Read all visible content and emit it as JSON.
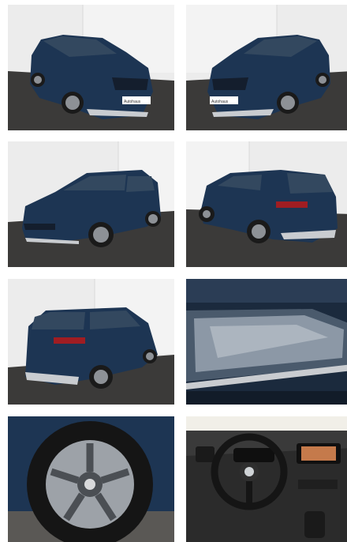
{
  "gallery": {
    "photos": [
      {
        "subject": "front-left exterior view",
        "plate_text": "Autohaus"
      },
      {
        "subject": "front-right exterior view",
        "plate_text": "Autohaus"
      },
      {
        "subject": "front-left three-quarter view",
        "plate_text": ""
      },
      {
        "subject": "rear-left exterior view",
        "plate_text": ""
      },
      {
        "subject": "rear-left three-quarter view",
        "plate_text": ""
      },
      {
        "subject": "headlight close-up",
        "plate_text": ""
      },
      {
        "subject": "alloy wheel close-up",
        "plate_text": ""
      },
      {
        "subject": "dashboard interior view",
        "plate_text": ""
      }
    ]
  },
  "colors": {
    "car_body": "#1d3553",
    "studio_wall": "#ececec",
    "studio_floor": "#3b3a39",
    "chrome": "#c9ccd0"
  }
}
